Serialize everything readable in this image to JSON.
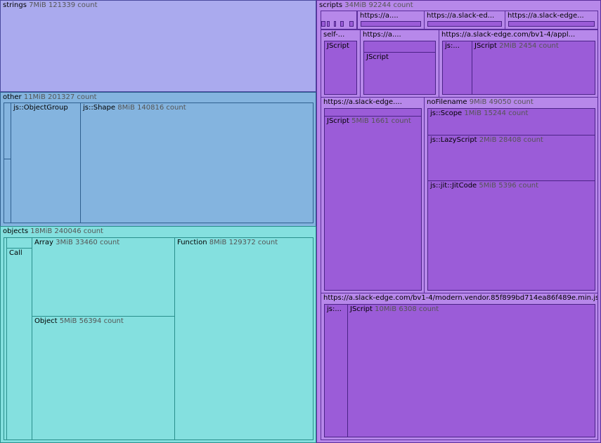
{
  "title": "",
  "groups": {
    "strings": {
      "name": "strings",
      "size": "7MiB",
      "count": "121339 count"
    },
    "other": {
      "name": "other",
      "size": "11MiB",
      "count": "201327 count"
    },
    "objects": {
      "name": "objects",
      "size": "18MiB",
      "count": "240046 count"
    },
    "scripts": {
      "name": "scripts",
      "size": "34MiB",
      "count": "92244 count"
    }
  },
  "other_children": {
    "object_group": {
      "name": "js::ObjectGroup"
    },
    "shape": {
      "name": "js::Shape",
      "size": "8MiB",
      "count": "140816 count"
    }
  },
  "objects_children": {
    "call": {
      "name": "Call"
    },
    "array": {
      "name": "Array",
      "size": "3MiB",
      "count": "33460 count"
    },
    "object": {
      "name": "Object",
      "size": "5MiB",
      "count": "56394 count"
    },
    "function": {
      "name": "Function",
      "size": "8MiB",
      "count": "129372 count"
    }
  },
  "scripts_children": {
    "top1": {
      "name": "https://a...."
    },
    "top2": {
      "name": "https://a.slack-ed..."
    },
    "top3": {
      "name": "https://a.slack-edge..."
    },
    "self": {
      "name": "self-...",
      "inner": "JScript"
    },
    "mid": {
      "name": "https://a....",
      "inner": "JScript"
    },
    "appl": {
      "name": "https://a.slack-edge.com/bv1-4/appl...",
      "js": "js:...",
      "jscript": "JScript",
      "size": "2MiB",
      "count": "2454 count"
    },
    "slack_left": {
      "name": "https://a.slack-edge....",
      "jscript": "JScript",
      "size": "5MiB",
      "count": "1661 count"
    },
    "nofile": {
      "name": "noFilename",
      "size": "9MiB",
      "count": "49050 count"
    },
    "scope": {
      "name": "js::Scope",
      "size": "1MiB",
      "count": "15244 count"
    },
    "lazy": {
      "name": "js::LazyScript",
      "size": "2MiB",
      "count": "28408 count"
    },
    "jit": {
      "name": "js::jit::JitCode",
      "size": "5MiB",
      "count": "5396 count"
    },
    "vendor": {
      "name": "https://a.slack-edge.com/bv1-4/modern.vendor.85f899bd714ea86f489e.min.js",
      "js": "js:...",
      "jscript": "JScript",
      "size": "10MiB",
      "count": "6308 count"
    }
  }
}
